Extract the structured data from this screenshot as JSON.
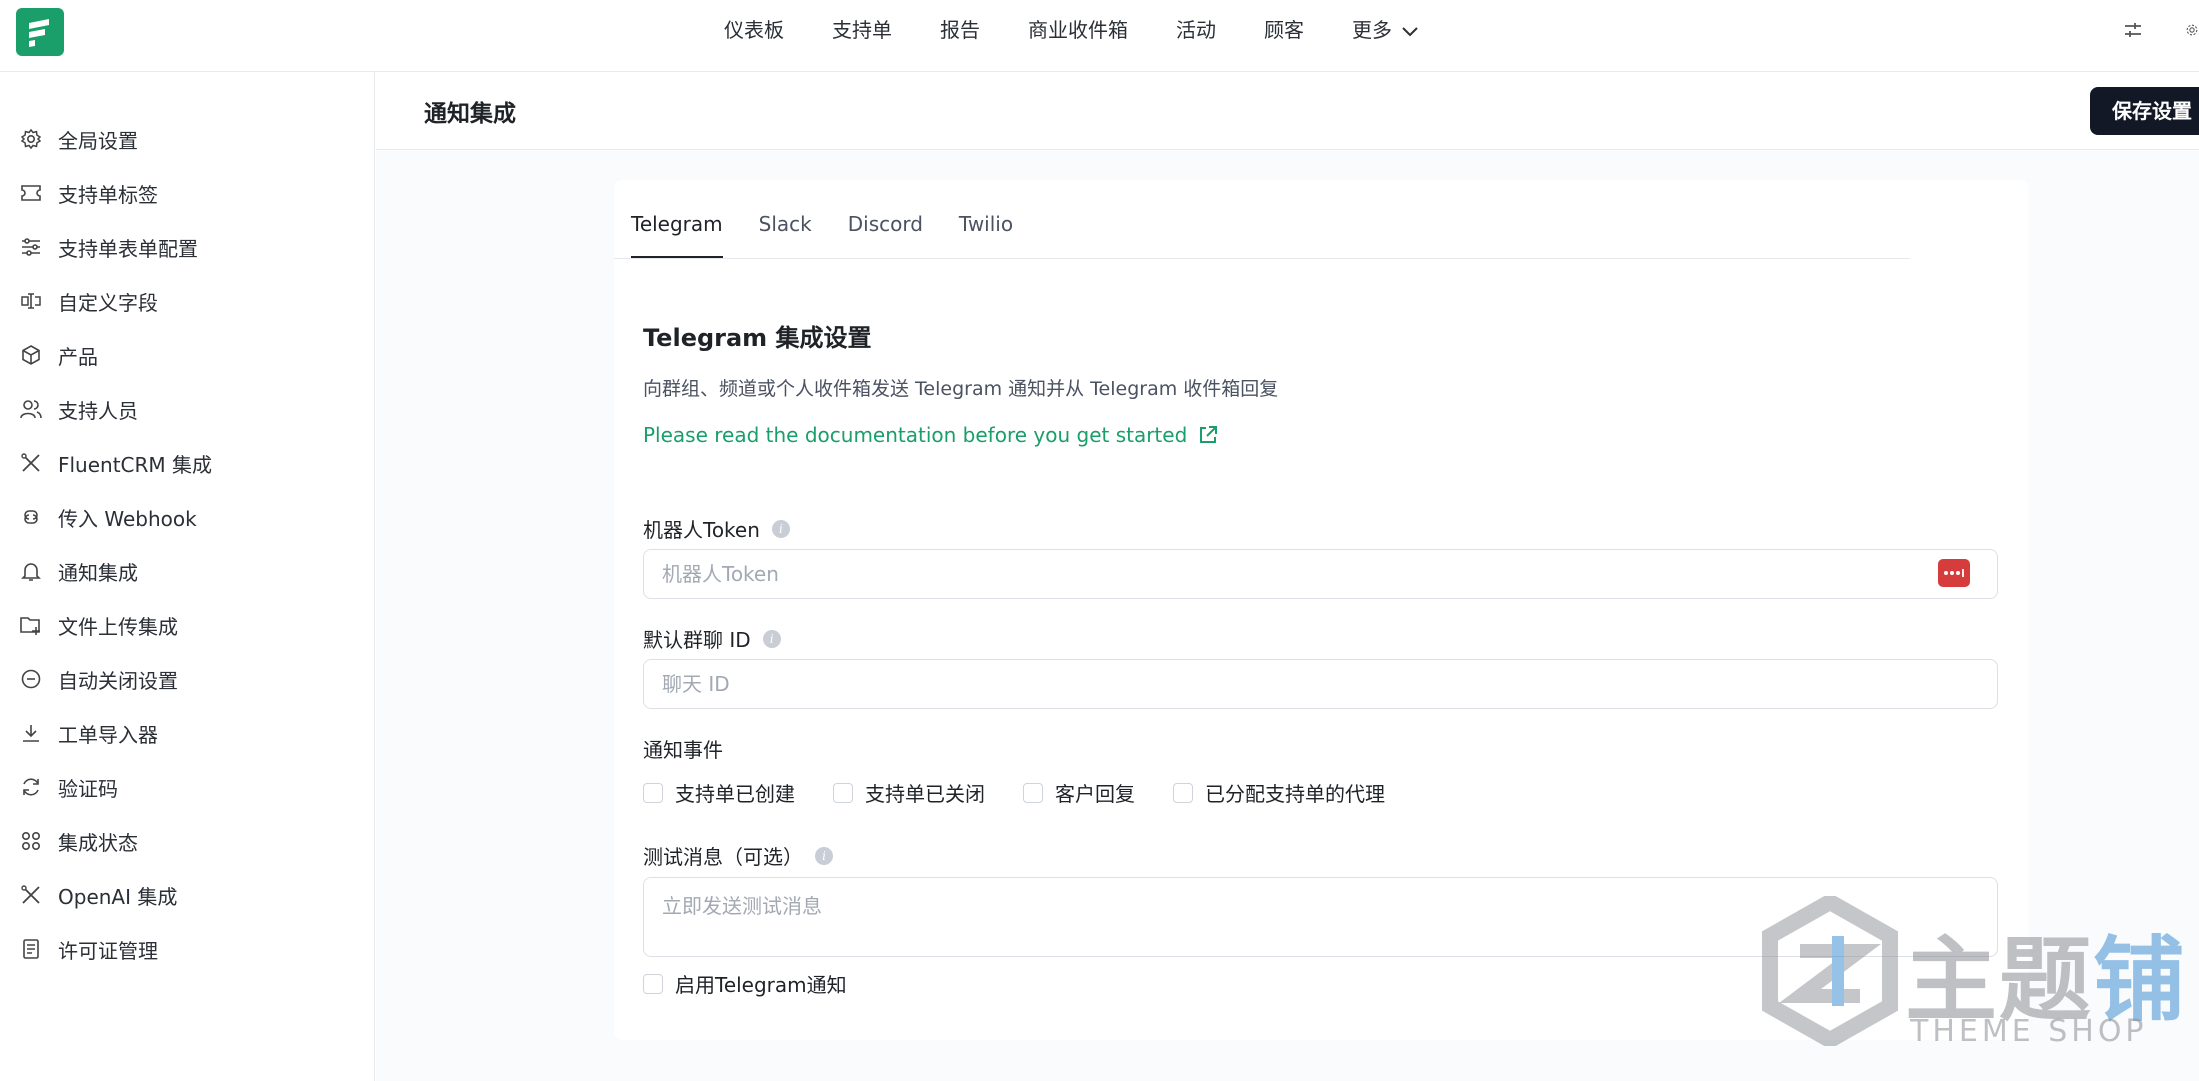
{
  "topnav": {
    "items": [
      "仪表板",
      "支持单",
      "报告",
      "商业收件箱",
      "活动",
      "顾客",
      "更多"
    ]
  },
  "sidebar": {
    "items": [
      {
        "label": "全局设置",
        "icon": "gear-icon"
      },
      {
        "label": "支持单标签",
        "icon": "ticket-icon"
      },
      {
        "label": "支持单表单配置",
        "icon": "sliders-icon"
      },
      {
        "label": "自定义字段",
        "icon": "text-cursor-icon"
      },
      {
        "label": "产品",
        "icon": "box-icon"
      },
      {
        "label": "支持人员",
        "icon": "users-icon"
      },
      {
        "label": "FluentCRM 集成",
        "icon": "tools-icon"
      },
      {
        "label": "传入 Webhook",
        "icon": "webhook-icon"
      },
      {
        "label": "通知集成",
        "icon": "bell-icon"
      },
      {
        "label": "文件上传集成",
        "icon": "folder-plus-icon"
      },
      {
        "label": "自动关闭设置",
        "icon": "minus-circle-icon"
      },
      {
        "label": "工单导入器",
        "icon": "download-icon"
      },
      {
        "label": "验证码",
        "icon": "refresh-icon"
      },
      {
        "label": "集成状态",
        "icon": "grid-dots-icon"
      },
      {
        "label": "OpenAI 集成",
        "icon": "tools-icon"
      },
      {
        "label": "许可证管理",
        "icon": "document-icon"
      }
    ]
  },
  "header": {
    "title": "通知集成",
    "save_label": "保存设置"
  },
  "tabs": [
    "Telegram",
    "Slack",
    "Discord",
    "Twilio"
  ],
  "form": {
    "title": "Telegram 集成设置",
    "description": "向群组、频道或个人收件箱发送 Telegram 通知并从 Telegram 收件箱回复",
    "doc_link": "Please read the documentation before you get started",
    "bot_token_label": "机器人Token",
    "bot_token_placeholder": "机器人Token",
    "chat_id_label": "默认群聊 ID",
    "chat_id_placeholder": "聊天 ID",
    "events_label": "通知事件",
    "events": [
      "支持单已创建",
      "支持单已关闭",
      "客户回复",
      "已分配支持单的代理"
    ],
    "test_label": "测试消息（可选）",
    "test_placeholder": "立即发送测试消息",
    "enable_label": "启用Telegram通知"
  },
  "watermark": {
    "cn_main": "主题",
    "cn_highlight": "铺",
    "en": "THEME SHOP"
  },
  "colors": {
    "brand_green": "#1a9e6a",
    "dark_button": "#121826",
    "password_badge": "#d63c3c"
  }
}
